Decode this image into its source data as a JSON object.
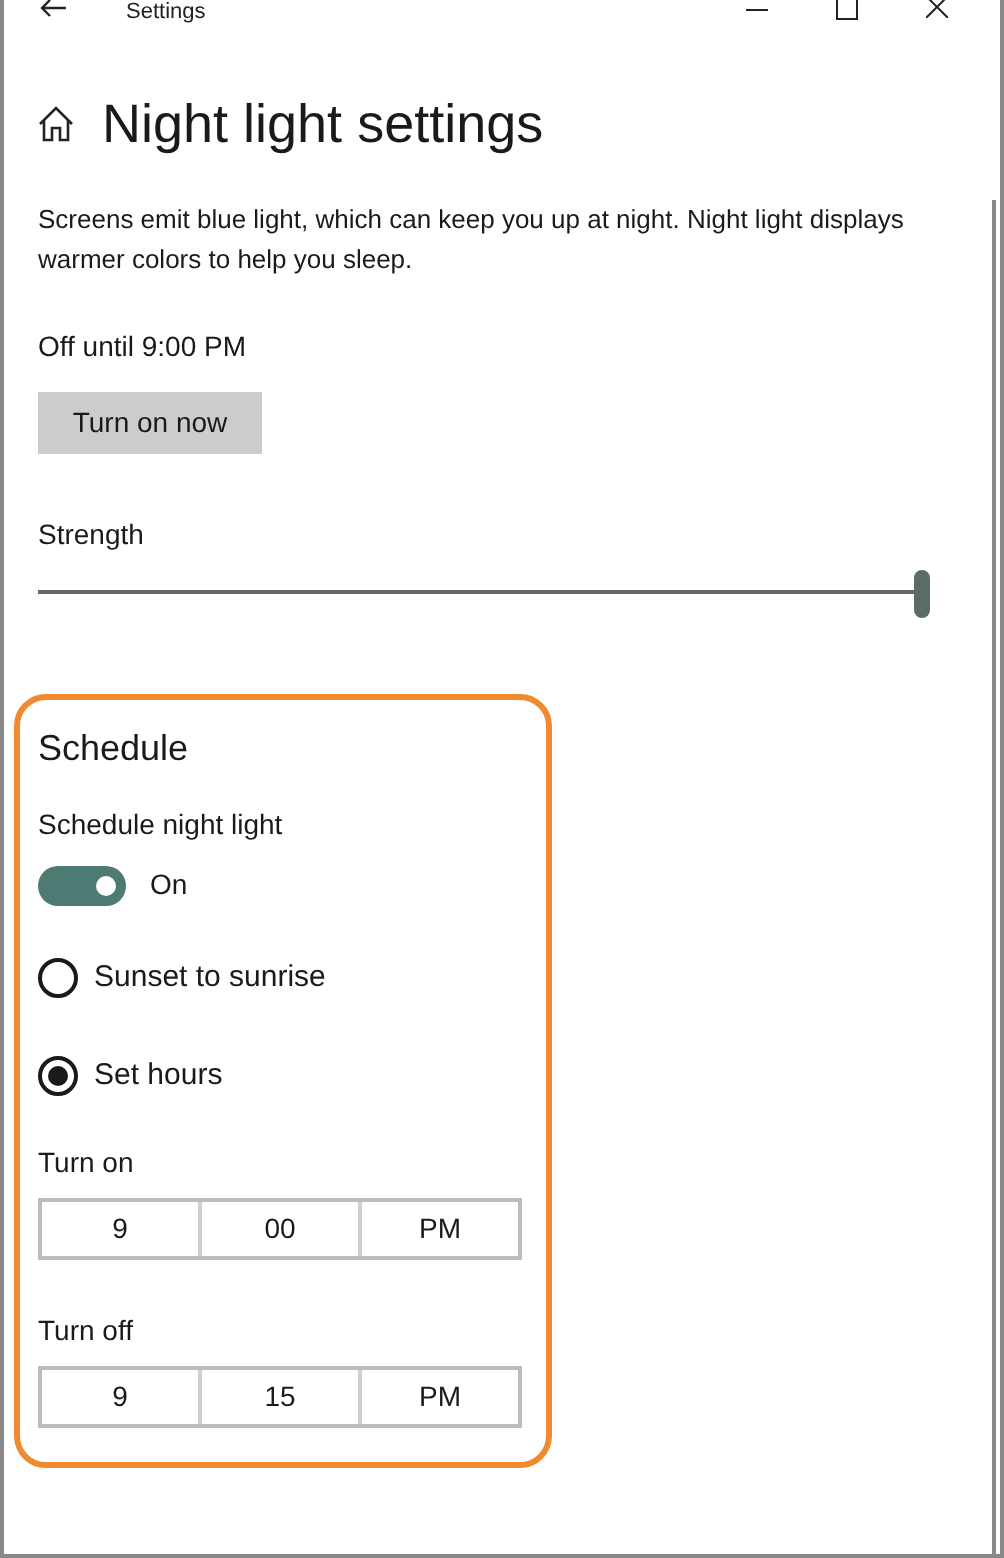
{
  "window": {
    "title": "Settings"
  },
  "page_title": "Night light settings",
  "description": "Screens emit blue light, which can keep you up at night. Night light displays warmer colors to help you sleep.",
  "status": "Off until 9:00 PM",
  "action_button": "Turn on now",
  "strength": {
    "label": "Strength",
    "level": 1.0
  },
  "schedule": {
    "title": "Schedule",
    "toggle": {
      "label": "Schedule night light",
      "on": true,
      "state_text": "On"
    },
    "options": [
      {
        "label": "Sunset to sunrise",
        "selected": false
      },
      {
        "label": "Set hours",
        "selected": true
      }
    ],
    "times": [
      {
        "label": "Turn on",
        "hour": "9",
        "minute": "00",
        "period": "PM"
      },
      {
        "label": "Turn off",
        "hour": "9",
        "minute": "15",
        "period": "PM"
      }
    ]
  }
}
